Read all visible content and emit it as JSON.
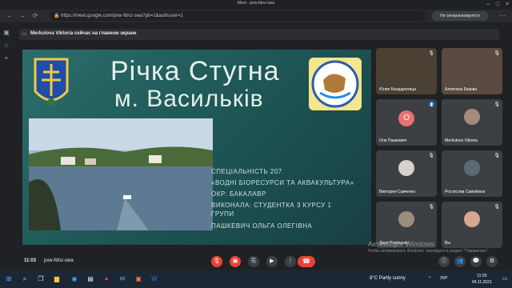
{
  "window": {
    "title": "Meet - pxw-fdnz-swa"
  },
  "browser": {
    "url": "https://meet.google.com/pxw-fdnz-swa?pli=1&authuser=1",
    "sync_button": "Не синхронизируется"
  },
  "notification": {
    "text": "Merkulova Viktoria сейчас на главном экране"
  },
  "slide": {
    "title_line1": "Річка Стугна",
    "title_line2": "м. Васильків",
    "info_lines": [
      "СПЕЦІАЛЬНІСТЬ 207",
      "«ВОДНІ БІОРЕСУРСИ ТА АКВАКУЛЬТУРА»",
      "ОКР: БАКАЛАВР",
      "ВИКОНАЛА: СТУДЕНТКА 3 КУРСУ 1",
      "ГРУПИ",
      "ПАШКЕВИЧ ОЛЬГА ОЛЕГІВНА"
    ]
  },
  "participants": [
    {
      "name": "Юлия Бондарелица"
    },
    {
      "name": "Алевтина Базова"
    },
    {
      "name": "Оля Пашкевич",
      "initial": "О",
      "color": "#e8716f"
    },
    {
      "name": "Merkulova Viktoria"
    },
    {
      "name": "Виктория Савченко"
    },
    {
      "name": "Ростислав Самойлюк"
    },
    {
      "name": "Даня Різніченко"
    },
    {
      "name": "Вы"
    }
  ],
  "meeting": {
    "time": "11:03",
    "code": "pxw-fdnz-swa"
  },
  "watermark": {
    "line1": "Активация Windows",
    "line2": "Чтобы активировать Windows, перейдите в раздел \"Параметры\"."
  },
  "taskbar": {
    "weather": "8°C  Partly sunny",
    "lang": "УКР",
    "time": "11:03",
    "date": "04.11.2021"
  },
  "colors": {
    "accent_red": "#ea4335",
    "slide_bg": "#1f5857"
  }
}
